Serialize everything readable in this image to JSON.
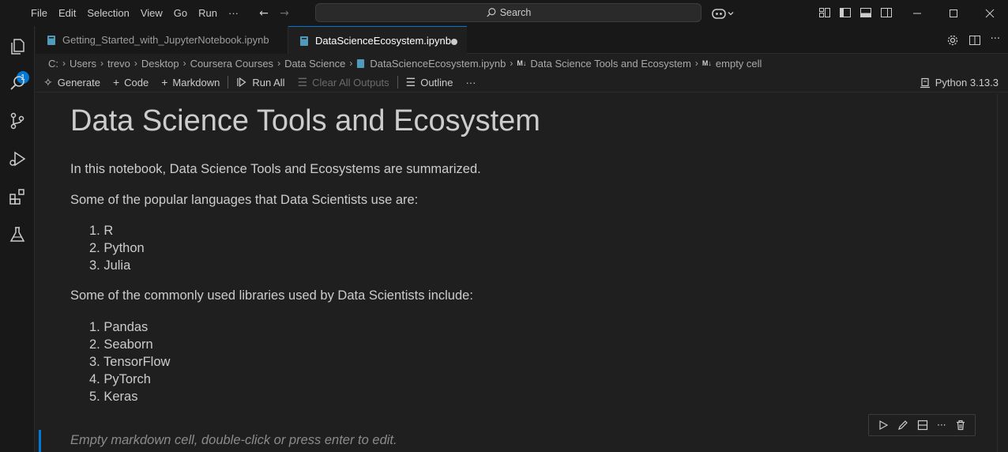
{
  "menu": [
    "File",
    "Edit",
    "Selection",
    "View",
    "Go",
    "Run",
    "···"
  ],
  "search": {
    "label": "Search"
  },
  "activity": {
    "explorer_badge": "1"
  },
  "tabs": [
    {
      "label": "Getting_Started_with_JupyterNotebook.ipynb",
      "active": false
    },
    {
      "label": "DataScienceEcosystem.ipynb",
      "active": true,
      "modified": true
    }
  ],
  "breadcrumb": {
    "items": [
      "C:",
      "Users",
      "trevo",
      "Desktop",
      "Coursera Courses",
      "Data Science",
      "DataScienceEcosystem.ipynb",
      "Data Science Tools and Ecosystem",
      "empty cell"
    ],
    "md_badge": "M↓"
  },
  "toolbar": {
    "generate": "Generate",
    "code": "Code",
    "markdown": "Markdown",
    "run_all": "Run All",
    "clear_outputs": "Clear All Outputs",
    "outline": "Outline",
    "more": "···",
    "kernel": "Python 3.13.3"
  },
  "notebook": {
    "title": "Data Science Tools and Ecosystem",
    "intro": "In this notebook, Data Science Tools and Ecosystems are summarized.",
    "languages_heading": "Some of the popular languages that Data Scientists use are:",
    "languages": [
      "1. R",
      "2. Python",
      "3. Julia"
    ],
    "libraries_heading": "Some of the commonly used libraries used by Data Scientists include:",
    "libraries": [
      "1. Pandas",
      "2. Seaborn",
      "3. TensorFlow",
      "4. PyTorch",
      "5. Keras"
    ],
    "empty_cell_placeholder": "Empty markdown cell, double-click or press enter to edit."
  },
  "colors": {
    "accent": "#0078d4",
    "background": "#1f1f1f",
    "chrome": "#181818"
  }
}
